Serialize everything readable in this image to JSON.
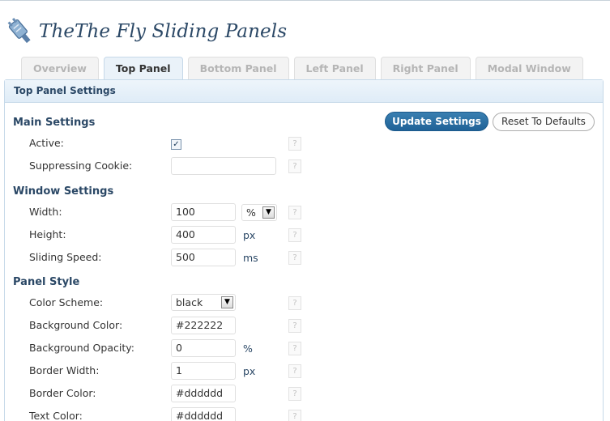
{
  "header": {
    "title": "TheThe Fly Sliding Panels",
    "icon": "plugin-icon"
  },
  "tabs": [
    {
      "label": "Overview",
      "active": false
    },
    {
      "label": "Top Panel",
      "active": true
    },
    {
      "label": "Bottom Panel",
      "active": false
    },
    {
      "label": "Left Panel",
      "active": false
    },
    {
      "label": "Right Panel",
      "active": false
    },
    {
      "label": "Modal Window",
      "active": false
    }
  ],
  "panel": {
    "title": "Top Panel Settings",
    "update_label": "Update Settings",
    "reset_label": "Reset To Defaults"
  },
  "main_settings": {
    "heading": "Main Settings",
    "active_label": "Active:",
    "active_checked": true,
    "cookie_label": "Suppressing Cookie:",
    "cookie_value": ""
  },
  "window_settings": {
    "heading": "Window Settings",
    "width_label": "Width:",
    "width_value": "100",
    "width_unit": "%",
    "height_label": "Height:",
    "height_value": "400",
    "height_unit": "px",
    "speed_label": "Sliding Speed:",
    "speed_value": "500",
    "speed_unit": "ms"
  },
  "panel_style": {
    "heading": "Panel Style",
    "scheme_label": "Color Scheme:",
    "scheme_value": "black",
    "bg_color_label": "Background Color:",
    "bg_color_value": "#222222",
    "bg_opacity_label": "Background Opacity:",
    "bg_opacity_value": "0",
    "bg_opacity_unit": "%",
    "border_width_label": "Border Width:",
    "border_width_value": "1",
    "border_width_unit": "px",
    "border_color_label": "Border Color:",
    "border_color_value": "#dddddd",
    "text_color_label": "Text Color:",
    "text_color_value": "#dddddd"
  },
  "help_glyph": "?",
  "check_glyph": "✓",
  "dropdown_glyph": "▼",
  "colors": {
    "accent": "#21759b",
    "heading": "#2b4866",
    "panel_border": "#c6d9e9"
  }
}
